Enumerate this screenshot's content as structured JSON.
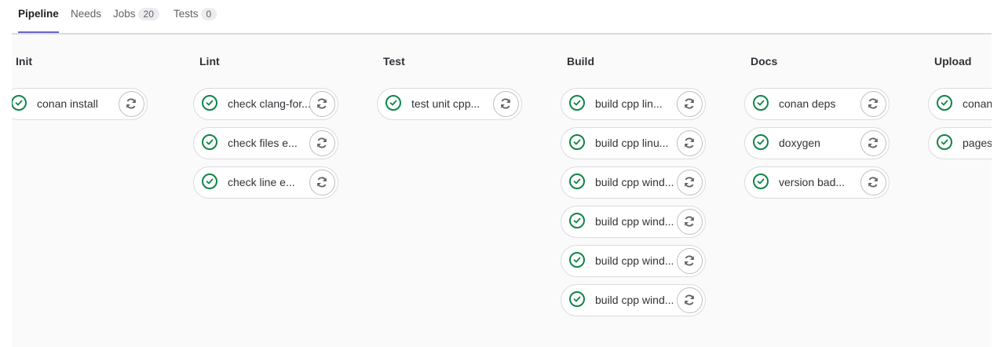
{
  "tabs": [
    {
      "label": "Pipeline",
      "active": true
    },
    {
      "label": "Needs"
    },
    {
      "label": "Jobs",
      "count": "20"
    },
    {
      "label": "Tests",
      "count": "0"
    }
  ],
  "stages": [
    {
      "name": "Init",
      "jobs": [
        "conan install"
      ]
    },
    {
      "name": "Lint",
      "jobs": [
        "check clang-for...",
        "check files e...",
        "check line e..."
      ]
    },
    {
      "name": "Test",
      "jobs": [
        "test unit cpp..."
      ]
    },
    {
      "name": "Build",
      "jobs": [
        "build cpp lin...",
        "build cpp linu...",
        "build cpp wind...",
        "build cpp wind...",
        "build cpp wind...",
        "build cpp wind..."
      ]
    },
    {
      "name": "Docs",
      "jobs": [
        "conan deps",
        "doxygen",
        "version bad..."
      ]
    },
    {
      "name": "Upload",
      "jobs": [
        "conan",
        "pages"
      ]
    }
  ],
  "colors": {
    "success": "#108548",
    "accent": "#6666c4"
  }
}
